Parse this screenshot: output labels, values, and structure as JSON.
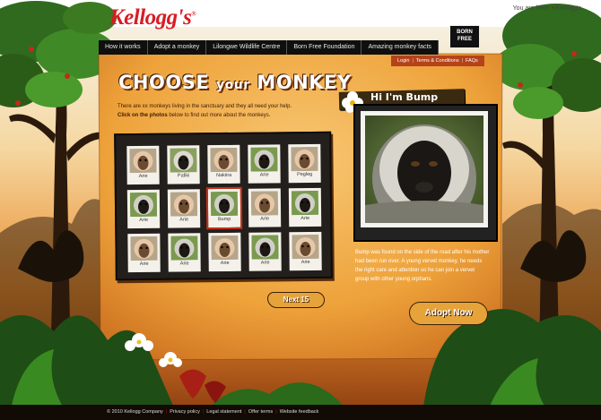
{
  "header": {
    "logo": "Kellogg's",
    "logo_mark": "®",
    "breadcrumb_prefix": "You are here:",
    "breadcrumb_current": "Kellogg's"
  },
  "nav": {
    "items": [
      {
        "label": "How it works"
      },
      {
        "label": "Adopt a monkey"
      },
      {
        "label": "Lilongwe Wildlife Centre"
      },
      {
        "label": "Born Free Foundation"
      },
      {
        "label": "Amazing monkey facts"
      }
    ]
  },
  "partner_logo": {
    "line1": "BORN",
    "line2": "FREE"
  },
  "utility_links": [
    {
      "label": "Login"
    },
    {
      "label": "Terms & Conditions"
    },
    {
      "label": "FAQs"
    }
  ],
  "main": {
    "title_part1": "CHOOSE",
    "title_part2": "your",
    "title_part3": "MONKEY",
    "intro_line1": "There are xx monkeys living in the sanctuary and they all need your help.",
    "intro_line2_bold": "Click on the photos",
    "intro_line2_rest": " below to find out more about the monkeys."
  },
  "monkeys": [
    {
      "name": "Arie",
      "tone": "a"
    },
    {
      "name": "Pafiki",
      "tone": "b"
    },
    {
      "name": "Nakiira",
      "tone": "a"
    },
    {
      "name": "Arie",
      "tone": "c"
    },
    {
      "name": "Pegleg",
      "tone": "a"
    },
    {
      "name": "Arie",
      "tone": "c"
    },
    {
      "name": "Arie",
      "tone": "a"
    },
    {
      "name": "Bump",
      "tone": "c",
      "selected": true
    },
    {
      "name": "Arie",
      "tone": "a"
    },
    {
      "name": "Arie",
      "tone": "c"
    },
    {
      "name": "Arie",
      "tone": "a"
    },
    {
      "name": "Arie",
      "tone": "c"
    },
    {
      "name": "Arie",
      "tone": "a"
    },
    {
      "name": "Arie",
      "tone": "c"
    },
    {
      "name": "Arie",
      "tone": "a"
    }
  ],
  "profile": {
    "title": "Hi I'm Bump",
    "description": "Bump was found on the side of the road after his mother had been run over. A young vervet monkey, he needs the right care and attention so he can join a vervet group with other young orphans."
  },
  "buttons": {
    "next": "Next 15",
    "adopt": "Adopt Now"
  },
  "footer": {
    "links": [
      {
        "label": "© 2010 Kellogg Company"
      },
      {
        "label": "Privacy policy"
      },
      {
        "label": "Legal statement"
      },
      {
        "label": "Offer terms"
      },
      {
        "label": "Website feedback"
      }
    ]
  },
  "colors": {
    "brand_red": "#d91c24",
    "panel_orange": "#f0a43a",
    "nav_black": "#0f0f0f",
    "accent_orange": "#b5431a"
  }
}
